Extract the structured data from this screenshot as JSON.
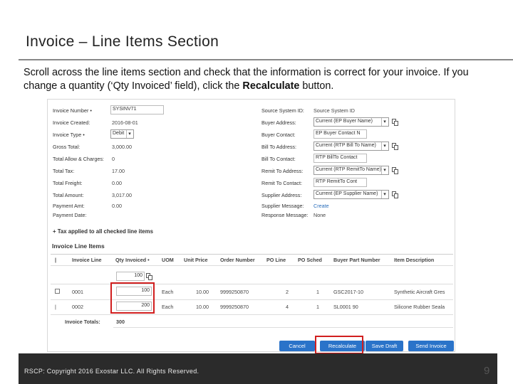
{
  "slide": {
    "title": "Invoice – Line Items Section",
    "desc_part1": "Scroll across the line items section and check that the information is correct for your invoice. If you change a quantity (‘Qty Invoiced’ field), click the ",
    "desc_bold": "Recalculate",
    "desc_part2": " button.",
    "footer": "RSCP: Copyright 2016 Exostar LLC. All Rights Reserved.",
    "page_number": "9"
  },
  "header_left": {
    "invoice_number_label": "Invoice Number •",
    "invoice_number_value": "SYSINV71",
    "invoice_created_label": "Invoice Created:",
    "invoice_created_value": "2016-08-01",
    "invoice_type_label": "Invoice Type •",
    "invoice_type_value": "Debit",
    "gross_total_label": "Gross Total:",
    "gross_total_value": "3,000.00",
    "allow_charges_label": "Total Allow & Charges:",
    "allow_charges_value": "0",
    "total_tax_label": "Total Tax:",
    "total_tax_value": "17.00",
    "total_freight_label": "Total Freight:",
    "total_freight_value": "0.00",
    "total_amount_label": "Total Amount:",
    "total_amount_value": "3,017.00",
    "payment_amt_label": "Payment Amt:",
    "payment_amt_value": "0.00",
    "payment_date_label": "Payment Date:"
  },
  "header_right": {
    "source_system_label": "Source System ID:",
    "source_system_value": "Source System ID",
    "buyer_address_label": "Buyer Address:",
    "buyer_address_value": "Current (EP Buyer Name)",
    "buyer_contact_label": "Buyer Contact:",
    "buyer_contact_value": "EP Buyer Contact N",
    "bill_to_address_label": "Bill To Address:",
    "bill_to_address_value": "Current (RTP Bill To Name)",
    "bill_to_contact_label": "Bill To Contact:",
    "bill_to_contact_value": "RTP BillTo Contact",
    "remit_to_address_label": "Remit To Address:",
    "remit_to_address_value": "Current (RTP RemitTo Name)",
    "remit_to_contact_label": "Remit To Contact:",
    "remit_to_contact_value": "RTP RemitTo Cont",
    "supplier_address_label": "Supplier Address:",
    "supplier_address_value": "Current (EP Supplier Name)",
    "supplier_message_label": "Supplier Message:",
    "supplier_message_link": "Create",
    "response_message_label": "Response Message:",
    "response_message_value": "None"
  },
  "tax_note": "+ Tax applied to all checked line items",
  "line_items": {
    "section_title": "Invoice Line Items",
    "columns": [
      "Invoice Line",
      "Qty Invoiced •",
      "UOM",
      "Unit Price",
      "Order Number",
      "PO Line",
      "PO Sched",
      "Buyer Part Number",
      "Item Description"
    ],
    "mass_qty_value": "100",
    "rows": [
      {
        "line": "0001",
        "qty": "100",
        "uom": "Each",
        "unit_price": "10.00",
        "order_number": "9999250870",
        "po_line": "2",
        "po_sched": "1",
        "buyer_part": "GSC2017-10",
        "description": "Synthetic Aircraft Gres"
      },
      {
        "line": "0002",
        "qty": "200",
        "uom": "Each",
        "unit_price": "10.00",
        "order_number": "9999250870",
        "po_line": "4",
        "po_sched": "1",
        "buyer_part": "SL0001 90",
        "description": "Silicone Rubber Seala"
      }
    ],
    "totals_label": "Invoice Totals:",
    "totals_value": "300"
  },
  "buttons": {
    "cancel": "Cancel",
    "recalculate": "Recalculate",
    "save_draft": "Save Draft",
    "send_invoice": "Send Invoice"
  },
  "colors": {
    "button_blue": "#2a73c9",
    "highlight_red": "#d11f1f",
    "footer_dark": "#2b2b2b"
  }
}
